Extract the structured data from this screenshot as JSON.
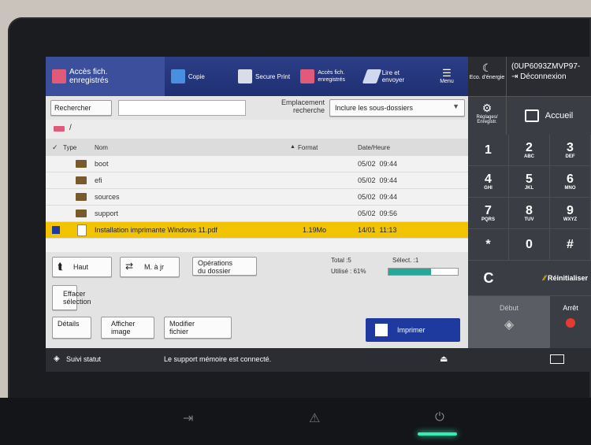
{
  "toolbar": {
    "stored_access": "Accès fich.\nenregistrés",
    "copy": "Copie",
    "secure_print": "Secure Print",
    "stored_access_small": "Accès fich.\nenregistrés",
    "read_send": "Lire et\nenvoyer",
    "menu": "Menu"
  },
  "right": {
    "eco": "Eco. d'énergie",
    "user_id": "(0UP6093ZMVP97-",
    "logout": "Déconnexion",
    "settings": "Réglages/\nEnregistr.",
    "home": "Accueil",
    "keys": [
      {
        "d": "1",
        "l": ""
      },
      {
        "d": "2",
        "l": "ABC"
      },
      {
        "d": "3",
        "l": "DEF"
      },
      {
        "d": "4",
        "l": "GHI"
      },
      {
        "d": "5",
        "l": "JKL"
      },
      {
        "d": "6",
        "l": "MNO"
      },
      {
        "d": "7",
        "l": "PQRS"
      },
      {
        "d": "8",
        "l": "TUV"
      },
      {
        "d": "9",
        "l": "WXYZ"
      },
      {
        "d": "*",
        "l": ""
      },
      {
        "d": "0",
        "l": ""
      },
      {
        "d": "#",
        "l": ""
      }
    ],
    "clear": "C",
    "reset": "Réinitialiser",
    "start": "Début",
    "stop": "Arrêt"
  },
  "search": {
    "button": "Rechercher",
    "location_label": "Emplacement\nrecherche",
    "location_value": "Inclure les sous-dossiers",
    "path": "/"
  },
  "table": {
    "headers": {
      "type": "Type",
      "name": "Nom",
      "format": "Format",
      "date": "Date/Heure"
    },
    "rows": [
      {
        "name": "boot",
        "format": "",
        "date": "05/02  09:44",
        "selected": false
      },
      {
        "name": "efi",
        "format": "",
        "date": "05/02  09:44",
        "selected": false
      },
      {
        "name": "sources",
        "format": "",
        "date": "05/02  09:44",
        "selected": false
      },
      {
        "name": "support",
        "format": "",
        "date": "05/02  09:56",
        "selected": false
      },
      {
        "name": "Installation imprimante Windows 11.pdf",
        "format": "1.19Mo",
        "date": "14/01  11:13",
        "selected": true
      }
    ]
  },
  "actions": {
    "up": "Haut",
    "refresh": "M. à jr",
    "folder_ops": "Opérations\ndu dossier",
    "total": "Total :5",
    "selected": "Sélect. :1",
    "used": "Utilisé : 61%",
    "used_fraction": 0.61,
    "clear_selection": "Effacer\nsélection",
    "details": "Détails",
    "show_image": "Afficher\nimage",
    "edit_file": "Modifier\nfichier",
    "print": "Imprimer"
  },
  "status": {
    "monitor": "Suivi statut",
    "message": "Le support mémoire est connecté."
  }
}
